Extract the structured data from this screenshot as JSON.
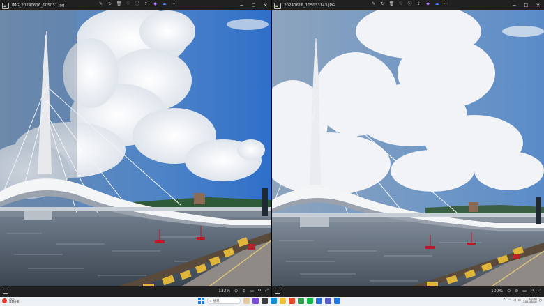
{
  "left_window": {
    "filename": "IMG_20240616_105031.jpg",
    "zoom": "133%"
  },
  "right_window": {
    "filename": "20240616_105033143.JPG",
    "zoom": "100%"
  },
  "toolbar_icons": [
    "edit-icon",
    "rotate-icon",
    "delete-icon",
    "favorite-icon",
    "info-icon",
    "share-icon",
    "copilot-icon",
    "onedrive-icon",
    "more-icon"
  ],
  "window_controls": {
    "minimize": "─",
    "maximize": "☐",
    "close": "✕"
  },
  "statusbar_icons": [
    "zoom-out-icon",
    "zoom-in-icon",
    "fit-icon",
    "compare-icon",
    "fullscreen-icon"
  ],
  "taskbar": {
    "weather_temp": "29°C",
    "weather_desc": "雲層分散",
    "search_placeholder": "搜尋",
    "time": "10:58",
    "date": "2024/6/18"
  },
  "colors": {
    "window_bg": "#202020",
    "taskbar_bg": "#eef1f4",
    "accent": "#1f7ae0",
    "copilot": "#b07cff",
    "onedrive": "#3d8bff"
  }
}
